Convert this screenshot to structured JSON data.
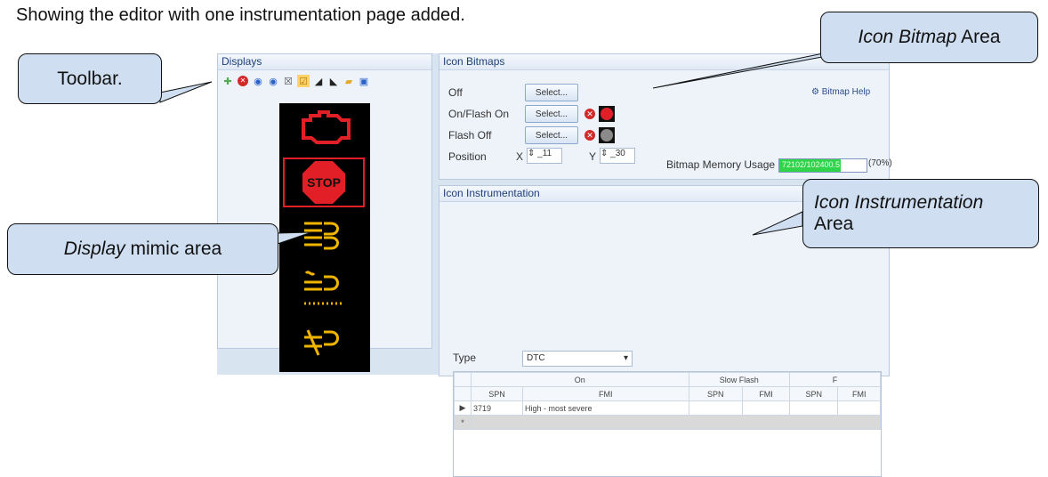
{
  "caption": "Showing the editor with one instrumentation page added.",
  "callouts": {
    "toolbar": "Toolbar.",
    "icon_bitmap_1": "Icon Bitmap",
    "icon_bitmap_2": "Area",
    "display_1": "Display",
    "display_2": " mimic area",
    "icon_inst_1": "Icon Instrumentation",
    "icon_inst_2": "Area"
  },
  "displays": {
    "title": "Displays"
  },
  "bitmaps": {
    "title": "Icon Bitmaps",
    "off": "Off",
    "on_flash": "On/Flash On",
    "flash_off": "Flash Off",
    "position": "Position",
    "x": "X",
    "y": "Y",
    "x_val": "_11",
    "y_val": "_30",
    "select": "Select...",
    "help": "Bitmap Help",
    "memory": "Bitmap Memory Usage",
    "memory_text": "72102/102400.5",
    "memory_pct": "(70%)",
    "memory_fraction": 0.7
  },
  "instrumentation": {
    "title": "Icon Instrumentation",
    "type_label": "Type",
    "type_value": "DTC",
    "groups": [
      "On",
      "Slow Flash",
      "F"
    ],
    "cols": [
      "SPN",
      "FMI",
      "SPN",
      "FMI",
      "SPN",
      "FMI"
    ],
    "row": {
      "spn": "3719",
      "fmi": "High - most severe"
    },
    "new_row_marker": "*"
  }
}
